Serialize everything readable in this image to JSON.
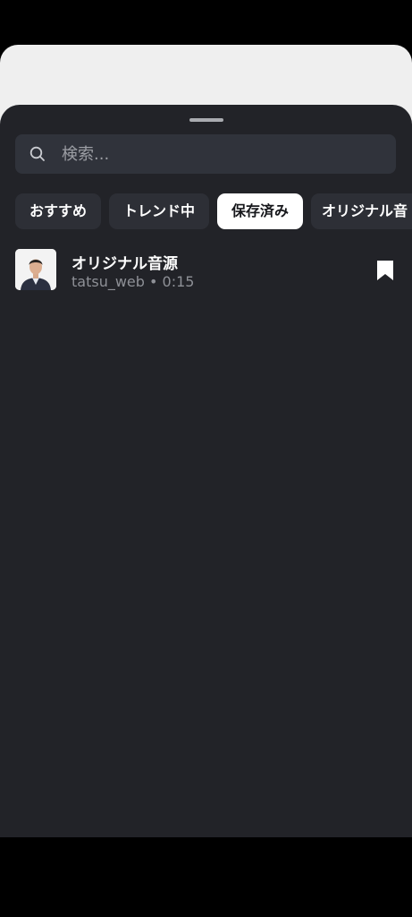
{
  "search": {
    "placeholder": "検索..."
  },
  "tabs": [
    {
      "label": "おすすめ",
      "active": false
    },
    {
      "label": "トレンド中",
      "active": false
    },
    {
      "label": "保存済み",
      "active": true
    },
    {
      "label": "オリジナル音",
      "active": false
    }
  ],
  "tracks": [
    {
      "title": "オリジナル音源",
      "meta": "tatsu_web • 0:15",
      "bookmarked": true
    }
  ],
  "icons": {
    "search": "search-icon",
    "bookmark": "bookmark-icon"
  },
  "colors": {
    "sheet_bg": "#222328",
    "search_bg": "#30333b",
    "tab_bg": "#2d2f36",
    "tab_active_bg": "#ffffff"
  }
}
